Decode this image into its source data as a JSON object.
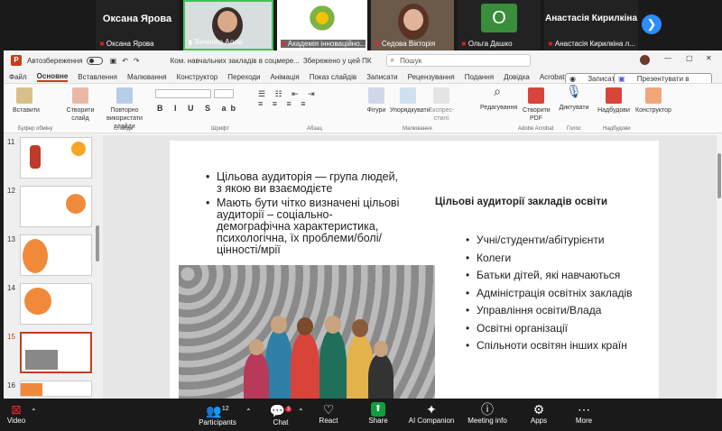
{
  "participants_gallery": [
    {
      "name": "Оксана Ярова",
      "caption": "Оксана Ярова",
      "has_video": false
    },
    {
      "name": "Зінченко Алла",
      "caption": "Зінченко Алла",
      "has_video": true
    },
    {
      "name": "Академія інноваційно...",
      "caption": "Академія інноваційно...",
      "has_video": true
    },
    {
      "name": "Седова Вікторія",
      "caption": "Седова Вікторія",
      "has_video": true
    },
    {
      "name": "О",
      "caption": "Ольга Дашко",
      "has_video": false
    },
    {
      "name": "Анастасія Кирилкіна",
      "caption": "Анастасія Кирилкіна л...",
      "has_video": false
    }
  ],
  "ppt": {
    "autosave_label": "Автозбереження",
    "doc_title": "Ком. навчальних закладів в соцмере...",
    "saved_status": "Збережено у цей ПК",
    "search_placeholder": "Пошук",
    "menu": [
      "Файл",
      "Основне",
      "Вставлення",
      "Малювання",
      "Конструктор",
      "Переходи",
      "Анімація",
      "Показ слайдів",
      "Записати",
      "Рецензування",
      "Подання",
      "Довідка",
      "Acrobat"
    ],
    "record_button": "Записати",
    "teams_button": "Презентувати в Teams",
    "ribbon": {
      "paste": "Вставити",
      "clipboard": "Буфер обміну",
      "new_slide": "Створити слайд",
      "reuse_slides": "Повторно використати слайди",
      "slides_group": "Слайди",
      "font_group": "Шрифт",
      "paragraph_group": "Абзац",
      "shapes": "Фігури",
      "arrange": "Упорядкувати",
      "quick_styles": "Експрес-стилі",
      "drawing_group": "Малювання",
      "editing": "Редагування",
      "create_pdf": "Створити PDF",
      "acrobat_group": "Adobe Acrobat",
      "dictate": "Диктувати",
      "voice_group": "Голос",
      "addins": "Надбудови",
      "addins_group": "Надбудови",
      "designer": "Конструктор"
    },
    "thumbnails": [
      {
        "num": "11"
      },
      {
        "num": "12"
      },
      {
        "num": "13"
      },
      {
        "num": "14"
      },
      {
        "num": "15"
      },
      {
        "num": "16"
      }
    ]
  },
  "slide": {
    "left_bullets": [
      "Цільова аудиторія — група людей, з якою ви взаємодієте",
      "Мають бути чітко визначені цільові аудиторії – соціально-демографічна характеристика, психологічна, їх проблеми/болі/цінності/мрії"
    ],
    "right_title": "Цільові аудиторії закладів освіти",
    "right_bullets": [
      "Учні/студенти/абітурієнти",
      "Колеги",
      "Батьки дітей, які навчаються",
      "Адміністрація освітніх закладів",
      "Управління освіти/Влада",
      "Освітні організації",
      "Спільноти освітян інших країн"
    ]
  },
  "zoom_bar": {
    "video": "Video",
    "participants": "Participants",
    "participants_count": "12",
    "chat": "Chat",
    "chat_badge": "3",
    "react": "React",
    "share": "Share",
    "ai": "AI Companion",
    "meeting_info": "Meeting info",
    "apps": "Apps",
    "more": "More"
  },
  "colors": {
    "accent_ppt": "#c43e1c",
    "zoom_share": "#0e9f3f",
    "zoom_blue": "#2d8cff"
  }
}
